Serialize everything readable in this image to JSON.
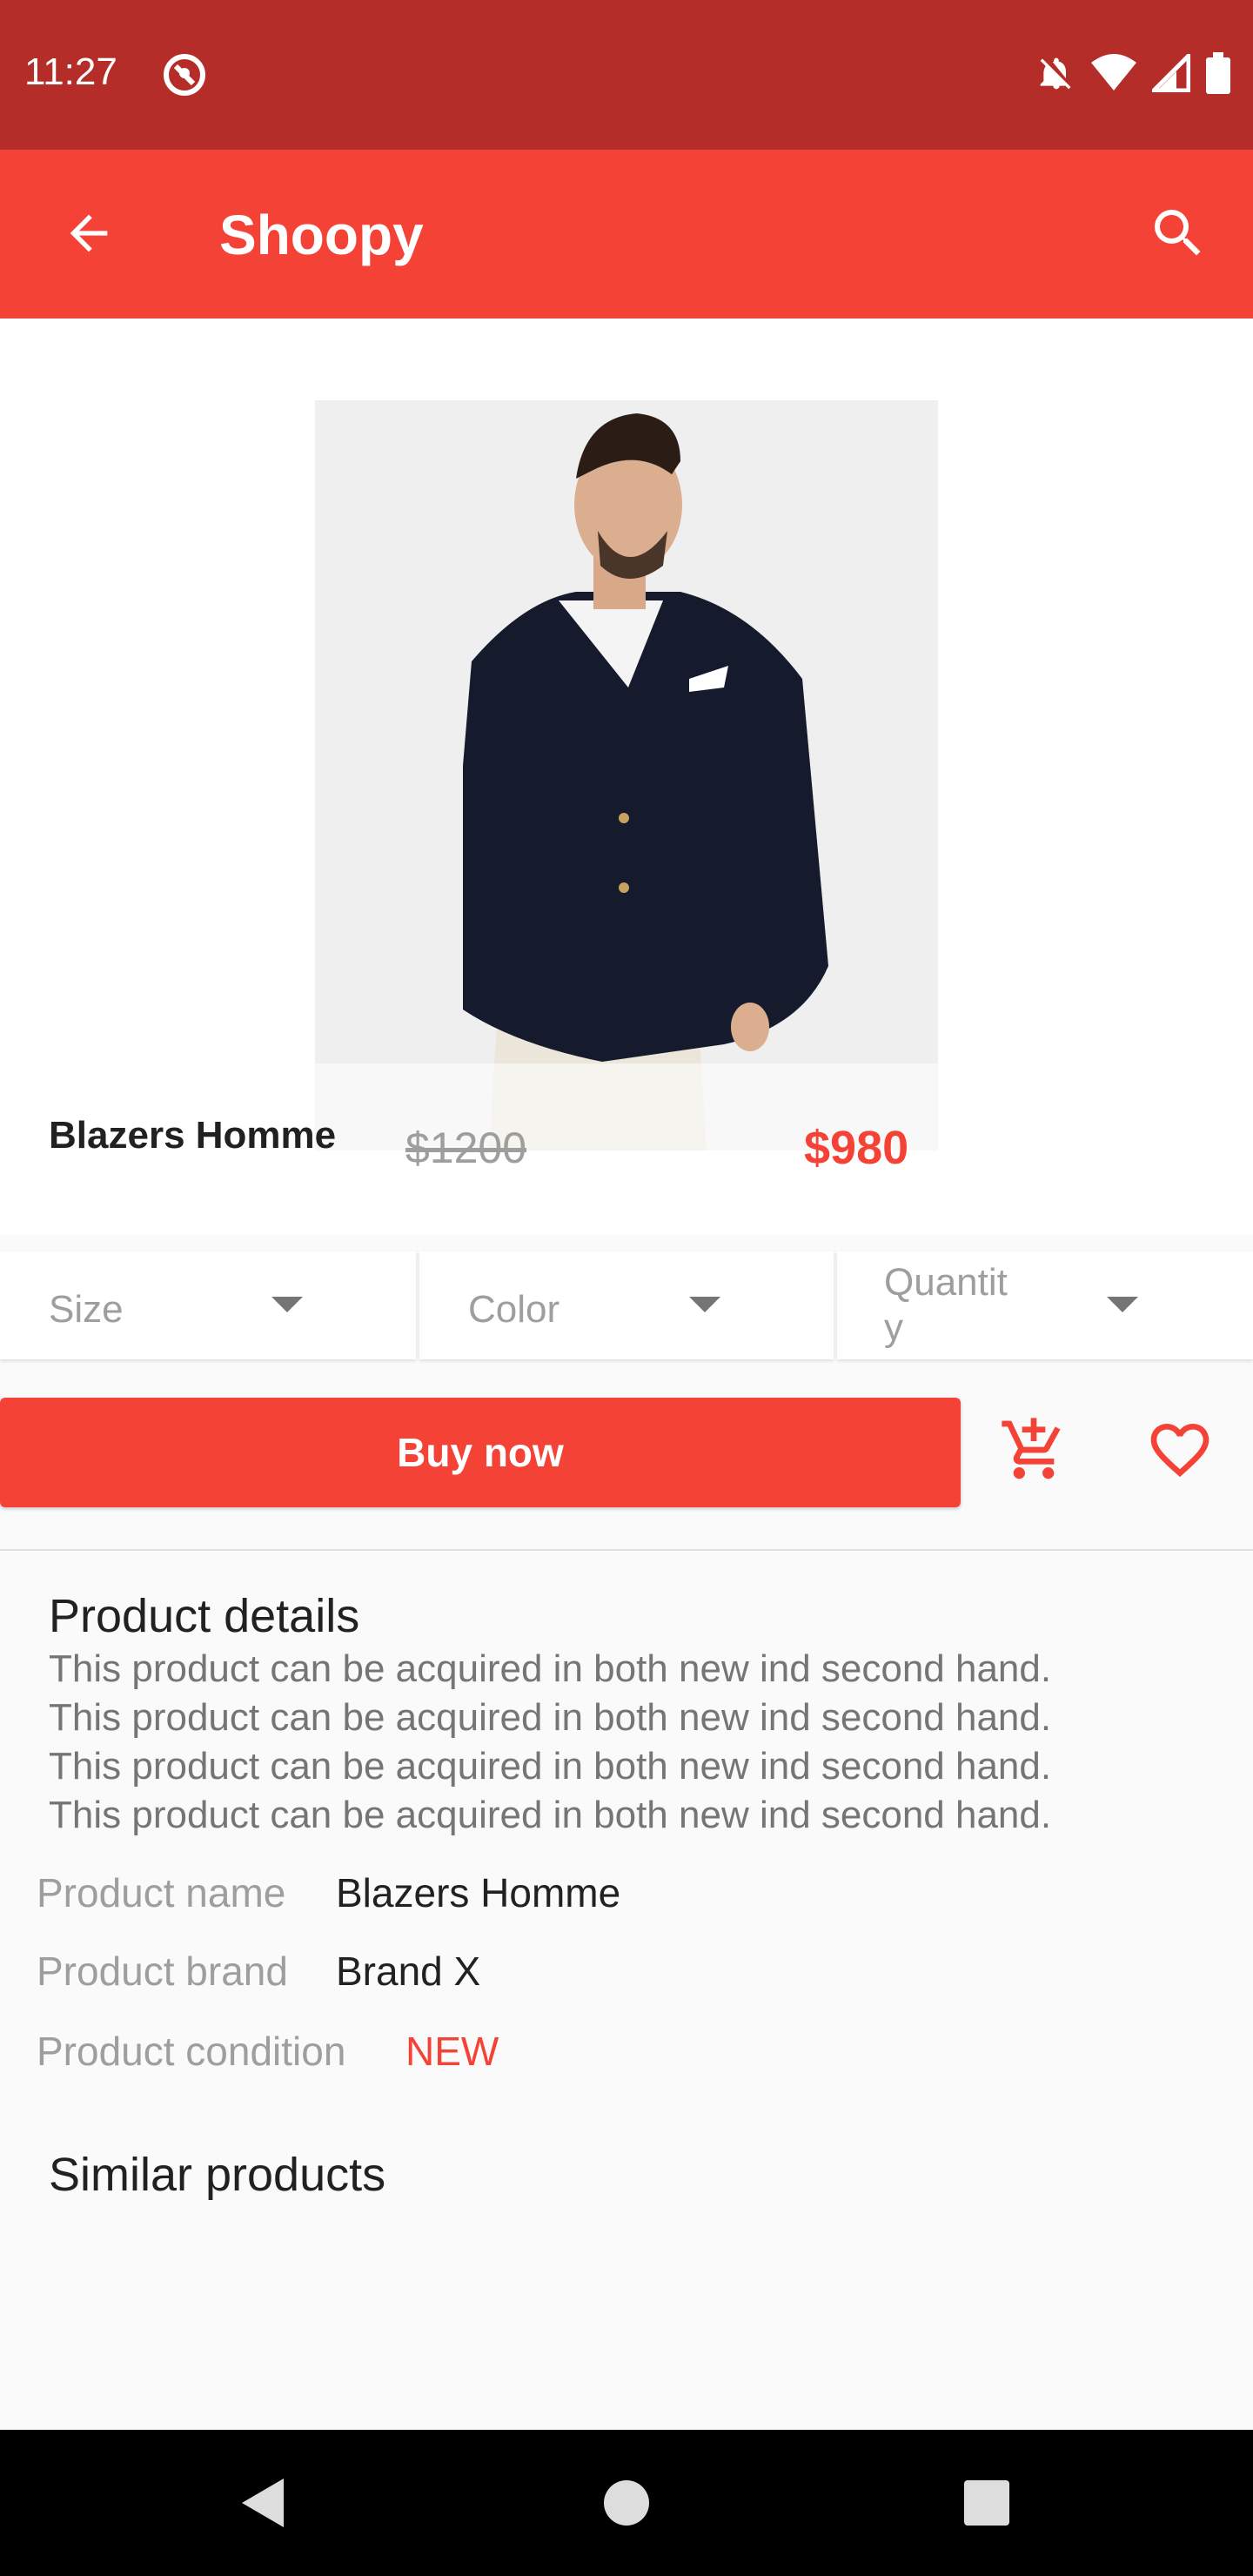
{
  "status_bar": {
    "time": "11:27"
  },
  "app_bar": {
    "title": "Shoopy"
  },
  "product": {
    "title": "Blazers Homme",
    "old_price": "$1200",
    "new_price": "$980"
  },
  "selectors": {
    "size": "Size",
    "color": "Color",
    "quantity_line1": "Quantit",
    "quantity_line2": "y"
  },
  "actions": {
    "buy_now": "Buy now"
  },
  "details": {
    "title": "Product details",
    "lines": [
      "This product can be acquired in both new ind second hand.",
      "This product can be acquired in both new ind second hand.",
      "This product can be acquired in both new ind second hand.",
      "This product can be acquired in both new ind second hand."
    ],
    "specs": {
      "name_key": "Product name",
      "name_val": "Blazers Homme",
      "brand_key": "Product brand",
      "brand_val": "Brand X",
      "condition_key": "Product condition",
      "condition_val": "NEW"
    }
  },
  "similar": {
    "title": "Similar products"
  },
  "colors": {
    "primary": "#f44336",
    "primary_dark": "#b52d28"
  },
  "icons": [
    "back-arrow-icon",
    "search-icon",
    "add-to-cart-icon",
    "heart-icon",
    "dropdown-arrow-icon",
    "wifi-icon",
    "signal-icon",
    "battery-icon",
    "notifications-off-icon"
  ]
}
